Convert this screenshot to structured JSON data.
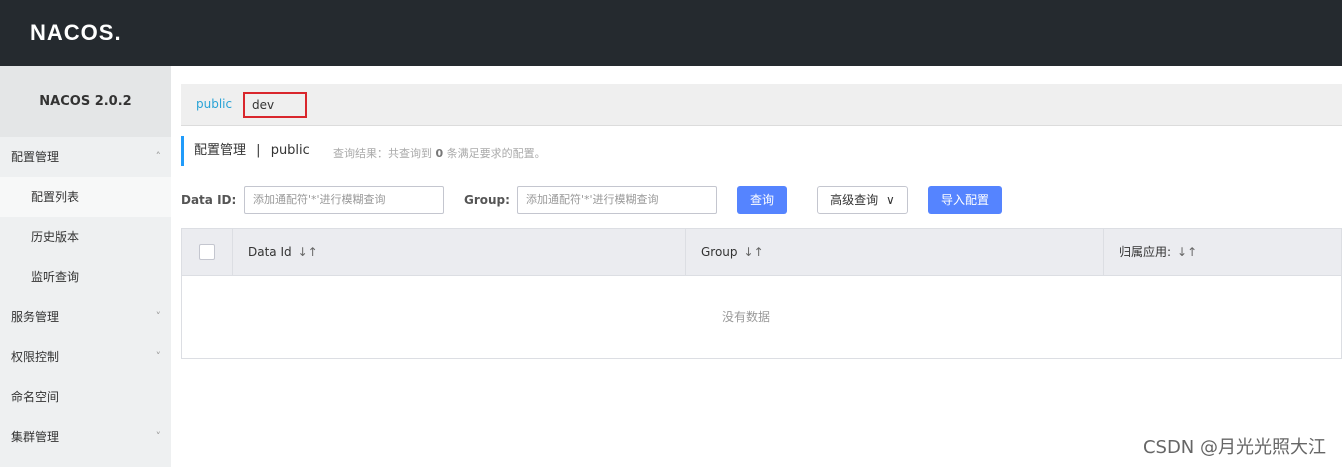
{
  "header": {
    "logo": "NACOS."
  },
  "sidebar": {
    "version": "NACOS 2.0.2",
    "items": [
      {
        "label": "配置管理",
        "type": "group",
        "chevron": "^"
      },
      {
        "label": "配置列表",
        "type": "sub",
        "active": true
      },
      {
        "label": "历史版本",
        "type": "sub"
      },
      {
        "label": "监听查询",
        "type": "sub"
      },
      {
        "label": "服务管理",
        "type": "group",
        "chevron": "v"
      },
      {
        "label": "权限控制",
        "type": "group",
        "chevron": "v"
      },
      {
        "label": "命名空间",
        "type": "group"
      },
      {
        "label": "集群管理",
        "type": "group",
        "chevron": "v"
      }
    ]
  },
  "namespaces": {
    "public": "public",
    "dev": "dev"
  },
  "title": {
    "main": "配置管理",
    "separator": "|",
    "namespace": "public"
  },
  "result_text": {
    "prefix": "查询结果：共查询到 ",
    "count": "0",
    "suffix": " 条满足要求的配置。"
  },
  "filters": {
    "data_id_label": "Data ID:",
    "data_id_placeholder": "添加通配符'*'进行模糊查询",
    "group_label": "Group:",
    "group_placeholder": "添加通配符'*'进行模糊查询",
    "search_button": "查询",
    "advanced_button": "高级查询",
    "import_button": "导入配置"
  },
  "table": {
    "columns": [
      "Data Id",
      "Group",
      "归属应用:"
    ],
    "sort_glyph": "↓↑",
    "empty_text": "没有数据"
  },
  "watermark": "CSDN @月光光照大江",
  "colors": {
    "topbar": "#252a2f",
    "primary": "#5584ff",
    "link": "#2aa3d6",
    "highlight": "#d9262c"
  }
}
